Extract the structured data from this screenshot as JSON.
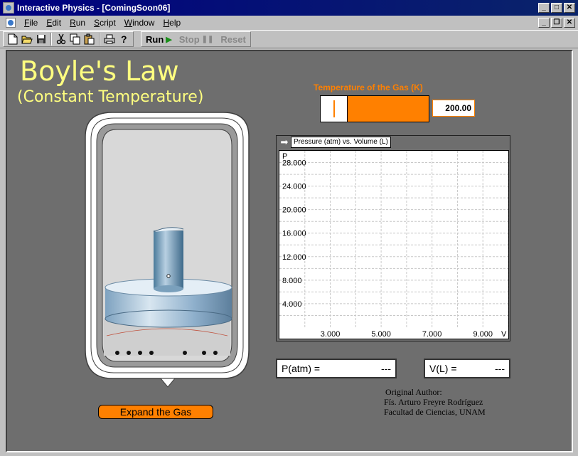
{
  "window": {
    "title": "Interactive Physics - [ComingSoon06]"
  },
  "menu": {
    "items": [
      {
        "label": "File",
        "key": "F",
        "rest": "ile"
      },
      {
        "label": "Edit",
        "key": "E",
        "rest": "dit"
      },
      {
        "label": "Run",
        "key": "R",
        "rest": "un"
      },
      {
        "label": "Script",
        "key": "S",
        "rest": "cript"
      },
      {
        "label": "Window",
        "key": "W",
        "rest": "indow"
      },
      {
        "label": "Help",
        "key": "H",
        "rest": "elp"
      }
    ]
  },
  "toolbar": {
    "icons": [
      "new-file-icon",
      "open-folder-icon",
      "save-icon",
      "cut-icon",
      "copy-icon",
      "paste-icon",
      "print-icon",
      "help-icon"
    ],
    "run_label": "Run",
    "stop_label": "Stop",
    "reset_label": "Reset"
  },
  "simulation": {
    "title": "Boyle's Law",
    "subtitle": "(Constant Temperature)",
    "temperature": {
      "label": "Temperature of the Gas (K)",
      "value": "200.00",
      "level": 0.0
    },
    "graph": {
      "title": "Pressure (atm) vs. Volume (L)"
    },
    "readouts": {
      "p_label": "P(atm) =",
      "p_value": "---",
      "v_label": "V(L) =",
      "v_value": "---"
    },
    "credits": {
      "line1": "Original Author:",
      "line2": "Fís. Arturo Freyre Rodríguez",
      "line3": "Facultad de Ciencias, UNAM"
    },
    "expand_button": "Expand the Gas"
  },
  "chart_data": {
    "type": "line",
    "title": "Pressure (atm) vs. Volume (L)",
    "xlabel": "V",
    "ylabel": "P",
    "x_ticks": [
      "3.000",
      "5.000",
      "7.000",
      "9.000"
    ],
    "y_ticks": [
      "4.000",
      "8.000",
      "12.000",
      "16.000",
      "20.000",
      "24.000",
      "28.000"
    ],
    "xlim": [
      1,
      10
    ],
    "ylim": [
      0,
      30
    ],
    "grid": true,
    "series": []
  }
}
